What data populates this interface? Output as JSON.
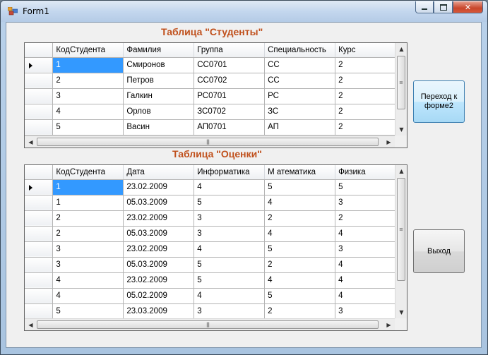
{
  "window": {
    "title": "Form1"
  },
  "students": {
    "caption": "Таблица \"Студенты\"",
    "headers": [
      "КодСтудента",
      "Фамилия",
      "Группа",
      "Специальность",
      "Курс"
    ],
    "rows": [
      [
        "1",
        "Смиронов",
        "СС0701",
        "СС",
        "2"
      ],
      [
        "2",
        "Петров",
        "СС0702",
        "СС",
        "2"
      ],
      [
        "3",
        "Галкин",
        "РС0701",
        "РС",
        "2"
      ],
      [
        "4",
        "Орлов",
        "ЗС0702",
        "ЗС",
        "2"
      ],
      [
        "5",
        "Васин",
        "АП0701",
        "АП",
        "2"
      ]
    ]
  },
  "grades": {
    "caption": "Таблица \"Оценки\"",
    "headers": [
      "КодСтудента",
      "Дата",
      "Информатика",
      "М атематика",
      "Физика"
    ],
    "rows": [
      [
        "1",
        "23.02.2009",
        "4",
        "5",
        "5"
      ],
      [
        "1",
        "05.03.2009",
        "5",
        "4",
        "3"
      ],
      [
        "2",
        "23.02.2009",
        "3",
        "2",
        "2"
      ],
      [
        "2",
        "05.03.2009",
        "3",
        "4",
        "4"
      ],
      [
        "3",
        "23.02.2009",
        "4",
        "5",
        "3"
      ],
      [
        "3",
        "05.03.2009",
        "5",
        "2",
        "4"
      ],
      [
        "4",
        "23.02.2009",
        "5",
        "4",
        "4"
      ],
      [
        "4",
        "05.02.2009",
        "4",
        "5",
        "4"
      ],
      [
        "5",
        "23.03.2009",
        "3",
        "2",
        "3"
      ]
    ]
  },
  "buttons": {
    "goto_form2": "Переход к форме2",
    "exit": "Выход"
  },
  "colors": {
    "caption": "#c0501c",
    "selection": "#3399ff"
  }
}
